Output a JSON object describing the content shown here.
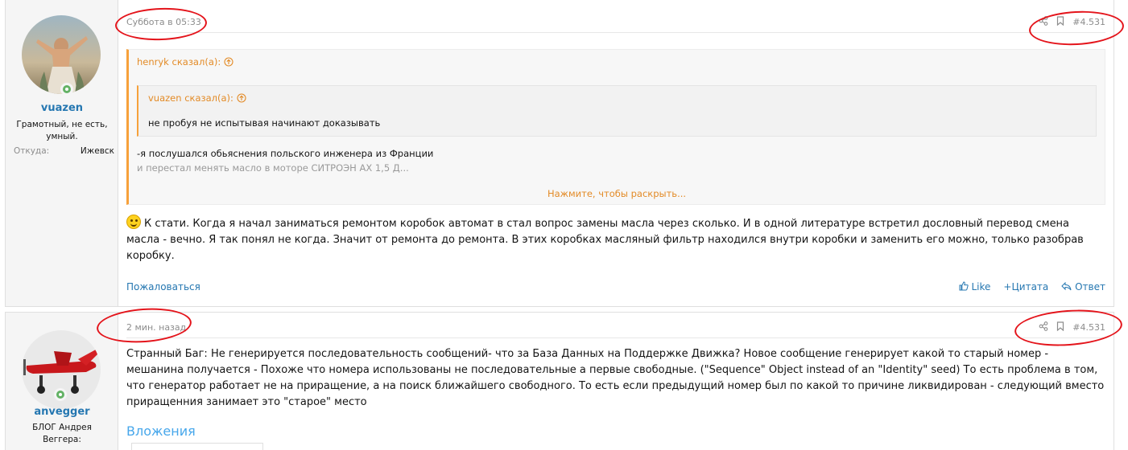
{
  "posts": [
    {
      "user": {
        "name": "vuazen",
        "title": "Грамотный, не есть, умный.",
        "location_label": "Откуда:",
        "location_value": "Ижевск"
      },
      "date": "Суббота в 05:33",
      "number": "#4.531",
      "quote": {
        "author": "henryk сказал(а):",
        "inner": {
          "author": "vuazen сказал(а):",
          "text": "не пробуя не испытывая начинают доказывать"
        },
        "line1": "-я послушался обьяснения польского инженера из Франции",
        "line2": "и перестал менять масло в моторе СИТРОЭН АХ 1,5 Д...",
        "expand": "Нажмите, чтобы раскрыть..."
      },
      "body": "К стати. Когда я начал заниматься ремонтом коробок автомат в стал вопрос замены масла через сколько. И в одной литературе встретил дословный перевод  смена масла - вечно. Я так понял не когда. Значит от ремонта до ремонта. В этих коробках масляный фильтр находился внутри коробки и заменить его можно, только  разобрав коробку.",
      "report": "Пожаловаться",
      "like": "Like",
      "quote_action": "Цитата",
      "reply": "Ответ"
    },
    {
      "user": {
        "name": "anvegger",
        "title": "БЛОГ Андрея Веггера:"
      },
      "date": "2 мин. назад",
      "number": "#4.531",
      "body": "Странный Баг: Не генерируется последовательность сообщений- что за База Данных на Поддержке Движка? Новое сообщение генерирует какой то старый номер - мешанина получается - Похоже что номера использованы не последовательные а первые свободные. (\"Sequence\" Object instead of an \"Identity\" seed) То есть проблема в том, что генератор работает не на приращение, а на поиск ближайшего свободного. То есть если предыдущий номер был по какой то причине ликвидирован - следующий вместо приращенния занимает это \"старое\" место",
      "attachments": "Вложения"
    }
  ],
  "colors": {
    "link": "#2577b1",
    "quote_accent": "#f7a13b",
    "annotation": "#e4141b",
    "online": "#63b265"
  }
}
